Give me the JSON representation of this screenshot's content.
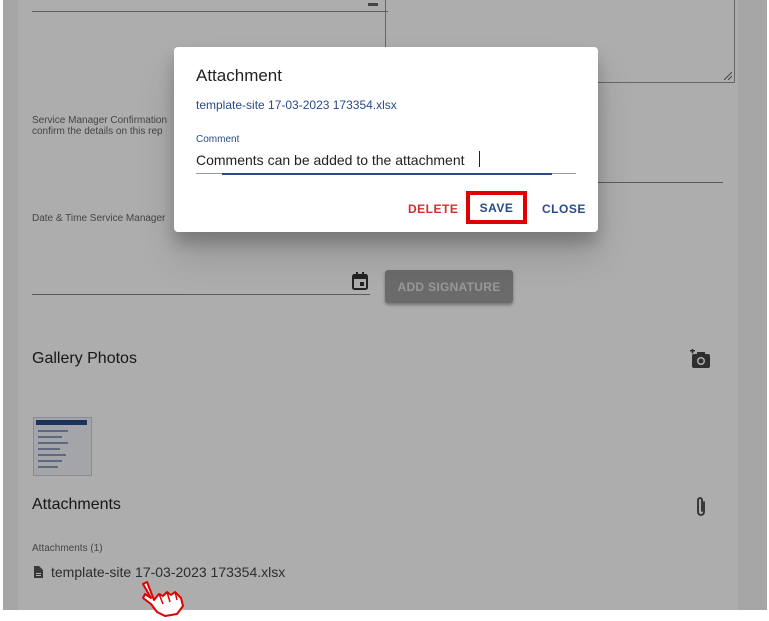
{
  "form": {
    "service_manager_label_line1": "Service Manager Confirmation",
    "service_manager_label_line2": "confirm the details on this rep",
    "date_time_label": "Date & Time Service Manager",
    "add_signature_label": "ADD SIGNATURE",
    "gallery_title": "Gallery Photos",
    "attachments_title": "Attachments",
    "attachments_count_label": "Attachments (1)",
    "attachment_file_name": "template-site 17-03-2023 173354.xlsx"
  },
  "dialog": {
    "title": "Attachment",
    "file_name": "template-site 17-03-2023 173354.xlsx",
    "comment_label": "Comment",
    "comment_value": "Comments can be added to the attachment",
    "delete_label": "DELETE",
    "save_label": "SAVE",
    "close_label": "CLOSE"
  },
  "colors": {
    "accent": "#2a4a8a",
    "delete": "#d32f2f",
    "highlight": "#e00000"
  },
  "icons": {
    "calendar": "calendar-icon",
    "add_photo": "add-photo-icon",
    "attach": "paperclip-icon",
    "file": "file-icon",
    "pointer": "hand-pointer-icon"
  }
}
